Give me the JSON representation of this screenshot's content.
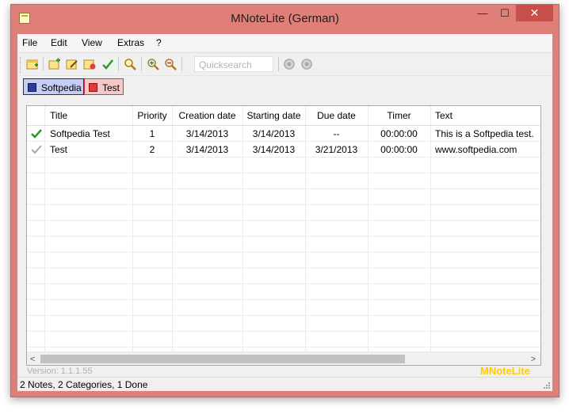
{
  "window": {
    "title": "MNoteLite (German)"
  },
  "titlebar_buttons": {
    "minimize": "—",
    "maximize": "☐",
    "close": "✕"
  },
  "menu": [
    "File",
    "Edit",
    "View",
    "Extras",
    "?"
  ],
  "toolbar": {
    "icons": [
      "new-note-icon",
      "new-category-icon",
      "edit-note-icon",
      "delete-note-icon",
      "mark-done-icon",
      "search-icon",
      "zoom-in-icon",
      "zoom-out-icon",
      "search-next-icon",
      "search-previous-icon"
    ],
    "quicksearch_placeholder": "Quicksearch"
  },
  "categories": [
    {
      "label": "Softpedia",
      "color": "#2f3a9e"
    },
    {
      "label": "Test",
      "color": "#e03a3a"
    }
  ],
  "table": {
    "columns": [
      "Title",
      "Priority",
      "Creation date",
      "Starting date",
      "Due date",
      "Timer",
      "Text"
    ],
    "rows": [
      {
        "done": true,
        "title": "Softpedia Test",
        "priority": "1",
        "creation": "3/14/2013",
        "starting": "3/14/2013",
        "due": "--",
        "timer": "00:00:00",
        "text": "This is a Softpedia test."
      },
      {
        "done": false,
        "title": "Test",
        "priority": "2",
        "creation": "3/14/2013",
        "starting": "3/14/2013",
        "due": "3/21/2013",
        "timer": "00:00:00",
        "text": "www.softpedia.com"
      }
    ]
  },
  "scroll": {
    "left": "<",
    "right": ">"
  },
  "footer": {
    "version": "Version: 1.1.1.55",
    "brand": "MNoteLite"
  },
  "status": "2 Notes, 2 Categories, 1 Done"
}
